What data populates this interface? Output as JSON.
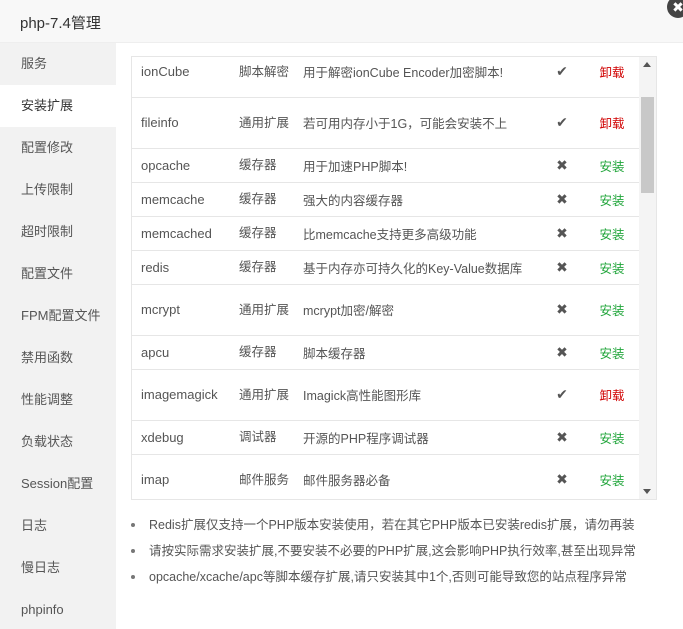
{
  "window": {
    "title": "php-7.4管理",
    "close_icon": "✖"
  },
  "sidebar": {
    "items": [
      {
        "label": "服务",
        "active": false
      },
      {
        "label": "安装扩展",
        "active": true
      },
      {
        "label": "配置修改",
        "active": false
      },
      {
        "label": "上传限制",
        "active": false
      },
      {
        "label": "超时限制",
        "active": false
      },
      {
        "label": "配置文件",
        "active": false
      },
      {
        "label": "FPM配置文件",
        "active": false
      },
      {
        "label": "禁用函数",
        "active": false
      },
      {
        "label": "性能调整",
        "active": false
      },
      {
        "label": "负载状态",
        "active": false
      },
      {
        "label": "Session配置",
        "active": false
      },
      {
        "label": "日志",
        "active": false
      },
      {
        "label": "慢日志",
        "active": false
      },
      {
        "label": "phpinfo",
        "active": false
      }
    ]
  },
  "extensions": {
    "rows": [
      {
        "name": "ionCube",
        "type": "脚本解密",
        "desc": "用于解密ionCube Encoder加密脚本!",
        "installed": true,
        "status_icon": "✔",
        "action": "卸载"
      },
      {
        "name": "fileinfo",
        "type": "通用扩展",
        "desc": "若可用内存小于1G，可能会安装不上",
        "installed": true,
        "status_icon": "✔",
        "action": "卸载"
      },
      {
        "name": "opcache",
        "type": "缓存器",
        "desc": "用于加速PHP脚本!",
        "installed": false,
        "status_icon": "✖",
        "action": "安装"
      },
      {
        "name": "memcache",
        "type": "缓存器",
        "desc": "强大的内容缓存器",
        "installed": false,
        "status_icon": "✖",
        "action": "安装"
      },
      {
        "name": "memcached",
        "type": "缓存器",
        "desc": "比memcache支持更多高级功能",
        "installed": false,
        "status_icon": "✖",
        "action": "安装"
      },
      {
        "name": "redis",
        "type": "缓存器",
        "desc": "基于内存亦可持久化的Key-Value数据库",
        "installed": false,
        "status_icon": "✖",
        "action": "安装"
      },
      {
        "name": "mcrypt",
        "type": "通用扩展",
        "desc": "mcrypt加密/解密",
        "installed": false,
        "status_icon": "✖",
        "action": "安装"
      },
      {
        "name": "apcu",
        "type": "缓存器",
        "desc": "脚本缓存器",
        "installed": false,
        "status_icon": "✖",
        "action": "安装"
      },
      {
        "name": "imagemagick",
        "type": "通用扩展",
        "desc": "Imagick高性能图形库",
        "installed": true,
        "status_icon": "✔",
        "action": "卸载"
      },
      {
        "name": "xdebug",
        "type": "调试器",
        "desc": "开源的PHP程序调试器",
        "installed": false,
        "status_icon": "✖",
        "action": "安装"
      },
      {
        "name": "imap",
        "type": "邮件服务",
        "desc": "邮件服务器必备",
        "installed": false,
        "status_icon": "✖",
        "action": "安装"
      }
    ]
  },
  "notes": [
    "Redis扩展仅支持一个PHP版本安装使用，若在其它PHP版本已安装redis扩展，请勿再装",
    "请按实际需求安装扩展,不要安装不必要的PHP扩展,这会影响PHP执行效率,甚至出现异常",
    "opcache/xcache/apc等脚本缓存扩展,请只安装其中1个,否则可能导致您的站点程序异常"
  ],
  "colors": {
    "install": "#20a53a",
    "uninstall": "#d00000",
    "sidebar_bg": "#f2f2f2"
  }
}
